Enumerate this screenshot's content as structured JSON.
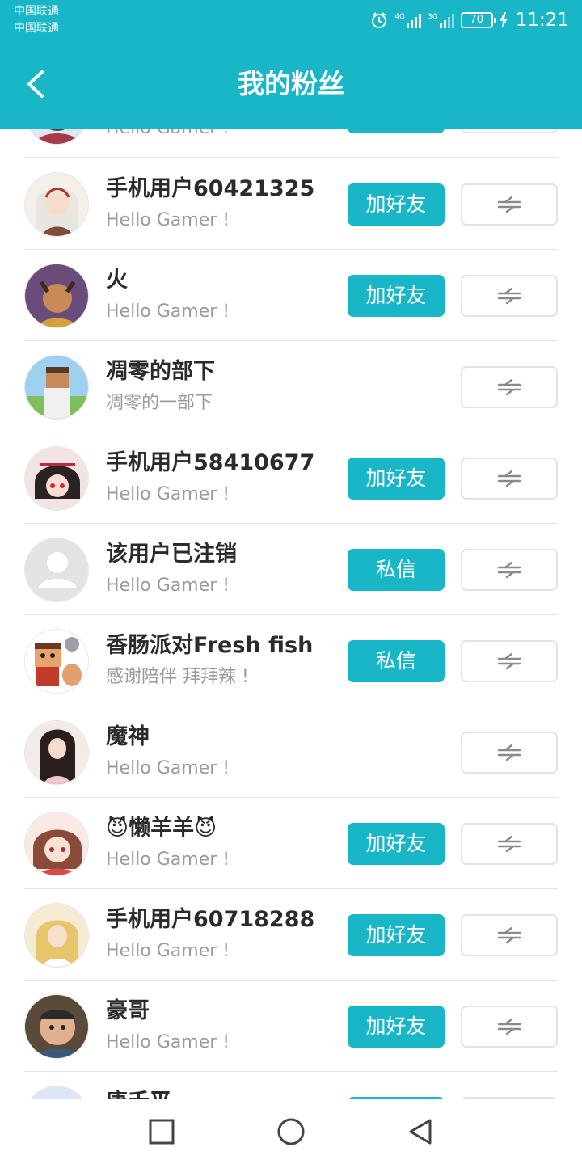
{
  "status_bar": {
    "carrier1": "中国联通",
    "carrier2": "中国联通",
    "sig1": "4G",
    "sig2": "3G",
    "battery": "70",
    "time": "11:21"
  },
  "header": {
    "title": "我的粉丝"
  },
  "partial_row_top": {
    "signature": "Hello Gamer !"
  },
  "rows": [
    {
      "name": "手机用户60421325",
      "signature": "Hello Gamer !",
      "button": "加好友"
    },
    {
      "name": "火",
      "signature": "Hello Gamer !",
      "button": "加好友"
    },
    {
      "name": "凋零的部下",
      "signature": "凋零的一部下",
      "button": ""
    },
    {
      "name": "手机用户58410677",
      "signature": "Hello Gamer !",
      "button": "加好友"
    },
    {
      "name": "该用户已注销",
      "signature": "Hello Gamer !",
      "button": "私信"
    },
    {
      "name": "香肠派对Fresh fish",
      "signature": "感谢陪伴 拜拜辣 !",
      "button": "私信"
    },
    {
      "name": "魔神",
      "signature": "Hello Gamer !",
      "button": ""
    },
    {
      "name": "😈懒羊羊😈",
      "signature": "Hello Gamer !",
      "button": "加好友"
    },
    {
      "name": "手机用户60718288",
      "signature": "Hello Gamer !",
      "button": "加好友"
    },
    {
      "name": "豪哥",
      "signature": "Hello Gamer !",
      "button": "加好友"
    }
  ],
  "partial_row_bottom": {
    "name": "唐禾平"
  },
  "icons": {
    "back": "chevron-left-icon",
    "swap": "swap-arrows-icon",
    "recents": "square-icon",
    "home": "circle-icon",
    "back_nav": "triangle-back-icon"
  },
  "colors": {
    "accent": "#18b6c6",
    "name_text": "#2b2b2b",
    "signature_text": "#9b9b9b",
    "divider": "#e3e3e3"
  }
}
